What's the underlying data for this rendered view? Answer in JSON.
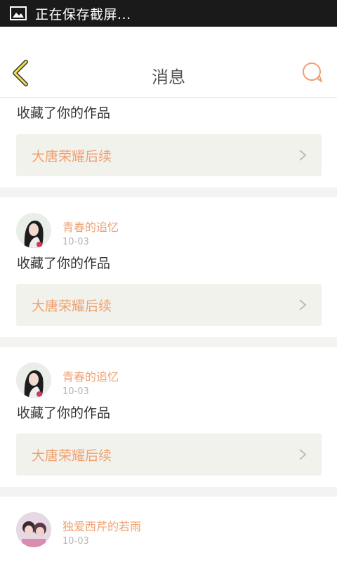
{
  "status_bar": {
    "text": "正在保存截屏..."
  },
  "header": {
    "title": "消息",
    "accent_color": "#f0a070"
  },
  "first_card": {
    "action": "收藏了你的作品",
    "work_title": "大唐荣耀后续"
  },
  "messages": [
    {
      "username": "青春的追忆",
      "date": "10-03",
      "action": "收藏了你的作品",
      "work_title": "大唐荣耀后续"
    },
    {
      "username": "青春的追忆",
      "date": "10-03",
      "action": "收藏了你的作品",
      "work_title": "大唐荣耀后续"
    },
    {
      "username": "独爱西芹的若雨",
      "date": "10-03"
    }
  ]
}
